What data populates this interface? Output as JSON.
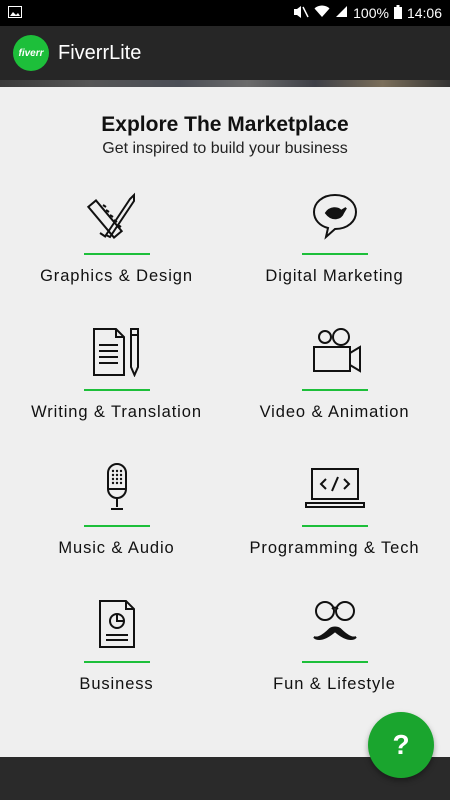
{
  "status": {
    "battery": "100%",
    "time": "14:06"
  },
  "app": {
    "logo_text": "fiverr",
    "title": "FiverrLite"
  },
  "main": {
    "title": "Explore The Marketplace",
    "subtitle": "Get inspired to build your business",
    "categories": [
      {
        "label": "Graphics & Design",
        "icon": "design-tools-icon"
      },
      {
        "label": "Digital Marketing",
        "icon": "speech-bubble-bird-icon"
      },
      {
        "label": "Writing & Translation",
        "icon": "document-pencil-icon"
      },
      {
        "label": "Video & Animation",
        "icon": "video-camera-icon"
      },
      {
        "label": "Music & Audio",
        "icon": "microphone-icon"
      },
      {
        "label": "Programming & Tech",
        "icon": "laptop-code-icon"
      },
      {
        "label": "Business",
        "icon": "report-document-icon"
      },
      {
        "label": "Fun & Lifestyle",
        "icon": "glasses-mustache-icon"
      }
    ]
  },
  "help_button": {
    "label": "?"
  },
  "colors": {
    "accent": "#1dbf3a",
    "app_bar": "#262626",
    "background": "#efefef"
  }
}
